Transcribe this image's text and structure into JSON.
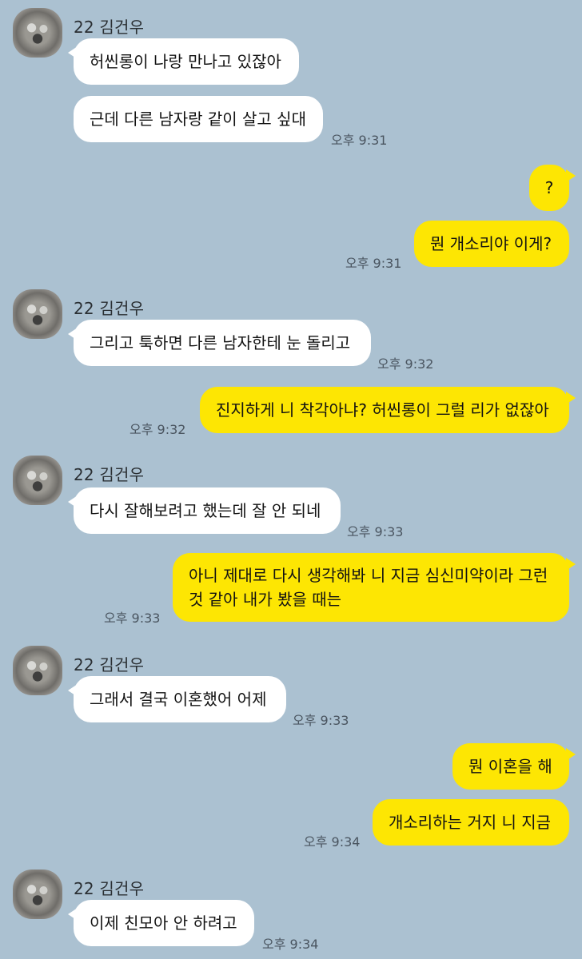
{
  "sender_name": "22 김건우",
  "colors": {
    "background": "#abc1d1",
    "incoming": "#ffffff",
    "outgoing": "#fde603"
  },
  "messages": [
    {
      "text": "허씬롱이 나랑 만나고 있잖아"
    },
    {
      "text": "근데 다른 남자랑 같이 살고 싶대",
      "time": "오후 9:31"
    },
    {
      "text": "?"
    },
    {
      "text": "뭔 개소리야 이게?",
      "time": "오후 9:31"
    },
    {
      "text": "그리고 툭하면 다른 남자한테 눈 돌리고",
      "time": "오후 9:32"
    },
    {
      "text": "진지하게 니 착각아냐? 허씬롱이 그럴 리가 없잖아",
      "time": "오후 9:32"
    },
    {
      "text": "다시 잘해보려고 했는데 잘 안 되네",
      "time": "오후 9:33"
    },
    {
      "line1": "아니 제대로 다시 생각해봐 니 지금 심신미약이라 그런",
      "line2": "것 같아 내가 봤을 때는",
      "time": "오후 9:33"
    },
    {
      "text": "그래서 결국 이혼했어 어제",
      "time": "오후 9:33"
    },
    {
      "text": "뭔 이혼을 해"
    },
    {
      "text": "개소리하는 거지 니 지금",
      "time": "오후 9:34"
    },
    {
      "text": "이제 친모아 안 하려고",
      "time": "오후 9:34"
    }
  ]
}
